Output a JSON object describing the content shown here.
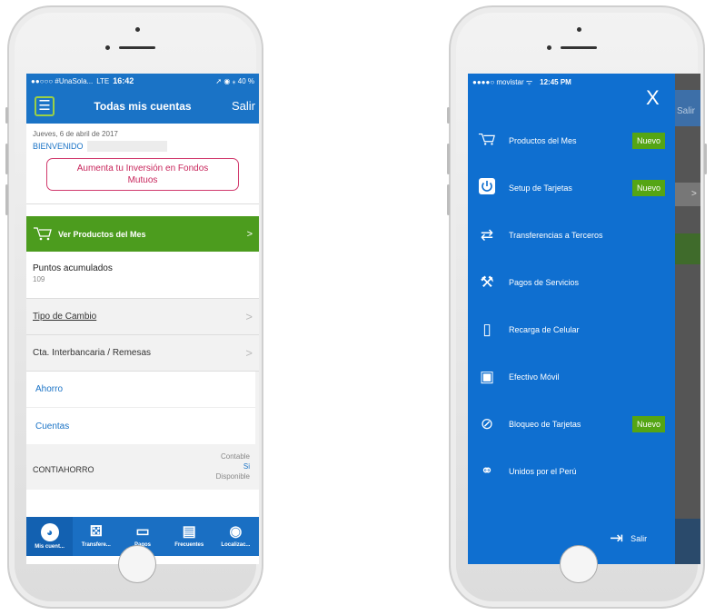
{
  "left": {
    "status": {
      "carrier": "●●○○○ #UnaSola...",
      "network": "LTE",
      "time": "16:42",
      "right": "➚ ◉ ⁎ 40 %"
    },
    "nav": {
      "menu_icon": "☰",
      "title": "Todas mis cuentas",
      "salir": "Salir"
    },
    "date": "Jueves, 6 de abril de 2017",
    "welcome": "BIENVENIDO",
    "promo": "Aumenta tu Inversión en Fondos Mutuos",
    "productos": {
      "label": "Ver Productos del Mes",
      "chevron": ">"
    },
    "puntos": {
      "label": "Puntos acumulados",
      "value": "109"
    },
    "rows": [
      {
        "label": "Tipo de Cambio",
        "chevron": ">"
      },
      {
        "label": "Cta. Interbancaria / Remesas",
        "chevron": ">"
      }
    ],
    "ahorro": "Ahorro",
    "cuentas": "Cuentas",
    "contiahorro": {
      "label": "CONTIAHORRO",
      "contable": "Contable",
      "si": "Si",
      "disponible": "Disponible",
      "chevron": ">"
    },
    "tabs": [
      {
        "label": "Mis cuent...",
        "icon": "◕"
      },
      {
        "label": "Transfere...",
        "icon": "⚄"
      },
      {
        "label": "Pagos",
        "icon": "▭"
      },
      {
        "label": "Frecuentes",
        "icon": "▤"
      },
      {
        "label": "Localizac...",
        "icon": "◉"
      }
    ]
  },
  "right": {
    "status": {
      "carrier": "●●●●○ movistar ᯤ",
      "time": "12:45 PM"
    },
    "close": "X",
    "menu": [
      {
        "label": "Productos del Mes",
        "icon": "🛒",
        "badge": "Nuevo"
      },
      {
        "label": "Setup de Tarjetas",
        "icon": "⏻",
        "badge": "Nuevo"
      },
      {
        "label": "Transferencias a Terceros",
        "icon": "⇄",
        "badge": ""
      },
      {
        "label": "Pagos de Servicios",
        "icon": "⚒",
        "badge": ""
      },
      {
        "label": "Recarga de Celular",
        "icon": "▯",
        "badge": ""
      },
      {
        "label": "Efectivo Móvil",
        "icon": "▣",
        "badge": ""
      },
      {
        "label": "Bloqueo de Tarjetas",
        "icon": "⊘",
        "badge": "Nuevo"
      },
      {
        "label": "Unidos por el Perú",
        "icon": "⚭",
        "badge": ""
      }
    ],
    "logout": "Salir",
    "logout_icon": "⇥",
    "bg_salir": "Salir",
    "bg_chevron": ">"
  }
}
